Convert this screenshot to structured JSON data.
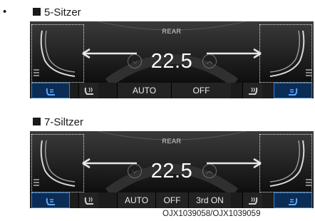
{
  "bullet": "•",
  "sections": [
    {
      "label": "5-Sitzer",
      "rear_label": "REAR",
      "temperature": "22.5",
      "buttons": [
        "AUTO",
        "OFF"
      ]
    },
    {
      "label": "7-Siltzer",
      "rear_label": "REAR",
      "temperature": "22.5",
      "buttons": [
        "AUTO",
        "OFF",
        "3rd ON"
      ]
    }
  ],
  "icons": {
    "temp_down": "chevron-down-icon",
    "temp_up": "chevron-up-icon",
    "seat_heat": "seat-heater-icon",
    "seat_ventilation": "seat-ventilation-icon",
    "airflow_arrow": "airflow-arrow-icon"
  },
  "colors": {
    "panel_bg": "#141414",
    "active_blue": "#2f7fd6",
    "text": "#ffffff"
  },
  "caption": "OJX1039058/OJX1039059"
}
